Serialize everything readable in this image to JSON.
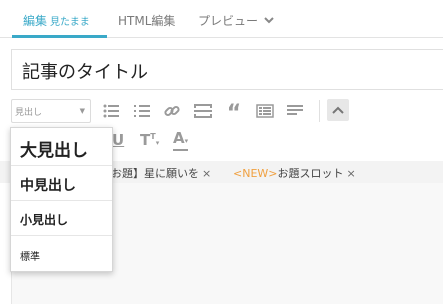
{
  "tabs": [
    {
      "label": "編集",
      "sub": "見たまま"
    },
    {
      "label": "HTML編集"
    },
    {
      "label": "プレビュー"
    }
  ],
  "accent_color": "#3aa9c8",
  "title": {
    "value": "記事のタイトル"
  },
  "toolbar": {
    "format_select": {
      "value": "見出し",
      "options": [
        "大見出し",
        "中見出し",
        "小見出し",
        "標準"
      ]
    },
    "icons": [
      "bullet-list-icon",
      "numbered-list-icon",
      "link-icon",
      "read-more-icon",
      "blockquote-icon",
      "table-icon",
      "horizontal-rule-icon",
      "collapse-up-icon"
    ]
  },
  "toolbar2": {
    "underline": "U",
    "text_size": "T",
    "text_color": "A"
  },
  "tags": [
    {
      "label": "お題】星に願いを"
    },
    {
      "prefix": "<NEW>",
      "label": "お題スロット"
    }
  ],
  "tag_remove": "×"
}
